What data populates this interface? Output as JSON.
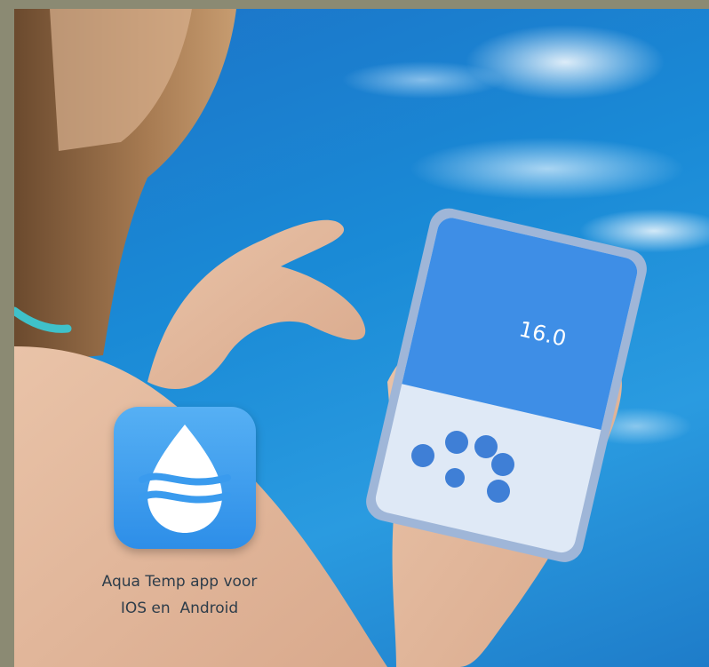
{
  "caption": {
    "line1": "Aqua Temp app voor",
    "line2": "IOS en  Android"
  },
  "phone_screen": {
    "temperature": "16.0"
  },
  "icons": {
    "app": "water-drop-waves-icon",
    "buttons": [
      "power-icon",
      "mode-icon",
      "timer-icon",
      "settings-icon",
      "add-icon",
      "schedule-icon",
      "info-icon"
    ]
  },
  "colors": {
    "pool": "#1a8ad6",
    "app_icon": "#3a9bee",
    "caption": "#2e3d4a",
    "border": "#8b8a73"
  }
}
